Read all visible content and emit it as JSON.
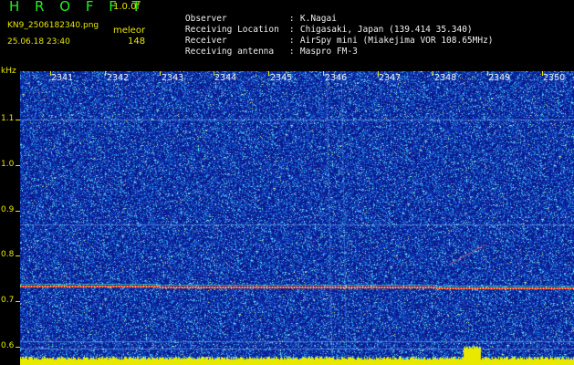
{
  "header": {
    "app_title": "H R O F F T",
    "version": "1.0.0f",
    "filename": "KN9_2506182340.png",
    "mode": "meleor",
    "datetime": "25.06.18 23:40",
    "count": "148",
    "info": [
      {
        "key": "Observer",
        "value": "K.Nagai"
      },
      {
        "key": "Receiving Location",
        "value": "Chigasaki, Japan (139.414 35.340)"
      },
      {
        "key": "Receiver",
        "value": "AirSpy mini (Miakejima VOR 108.65MHz)"
      },
      {
        "key": "Receiving antenna",
        "value": "Maspro FM-3"
      }
    ]
  },
  "axis": {
    "y_unit": "kHz",
    "y_ticks": [
      "1.1",
      "1.0",
      "0.9",
      "0.8",
      "0.7",
      "0.6"
    ],
    "x_ticks": [
      "2341",
      "2342",
      "2343",
      "2344",
      "2345",
      "2346",
      "2347",
      "2348",
      "2349",
      "2350"
    ]
  },
  "colors": {
    "background": "#000000",
    "noise_dark": "#0a1a8c",
    "signal": "#ff3030",
    "label_yellow": "#e8e800",
    "title_green": "#22ee22"
  }
}
